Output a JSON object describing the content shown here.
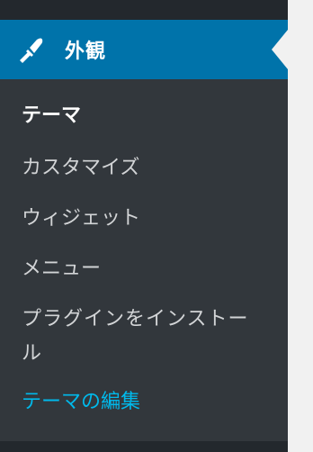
{
  "menu": {
    "active_item": {
      "label": "外観",
      "icon": "paintbrush-icon"
    },
    "submenu": {
      "items": [
        {
          "label": "テーマ",
          "state": "current"
        },
        {
          "label": "カスタマイズ",
          "state": "normal"
        },
        {
          "label": "ウィジェット",
          "state": "normal"
        },
        {
          "label": "メニュー",
          "state": "normal"
        },
        {
          "label": "プラグインをインストール",
          "state": "normal"
        },
        {
          "label": "テーマの編集",
          "state": "hover"
        }
      ]
    }
  },
  "colors": {
    "menu_background": "#23282d",
    "submenu_background": "#32373c",
    "active_background": "#0073aa",
    "link_hover": "#00b9eb",
    "text_default": "#d2d4d6",
    "text_current": "#ffffff",
    "content_background": "#f1f1f1"
  }
}
